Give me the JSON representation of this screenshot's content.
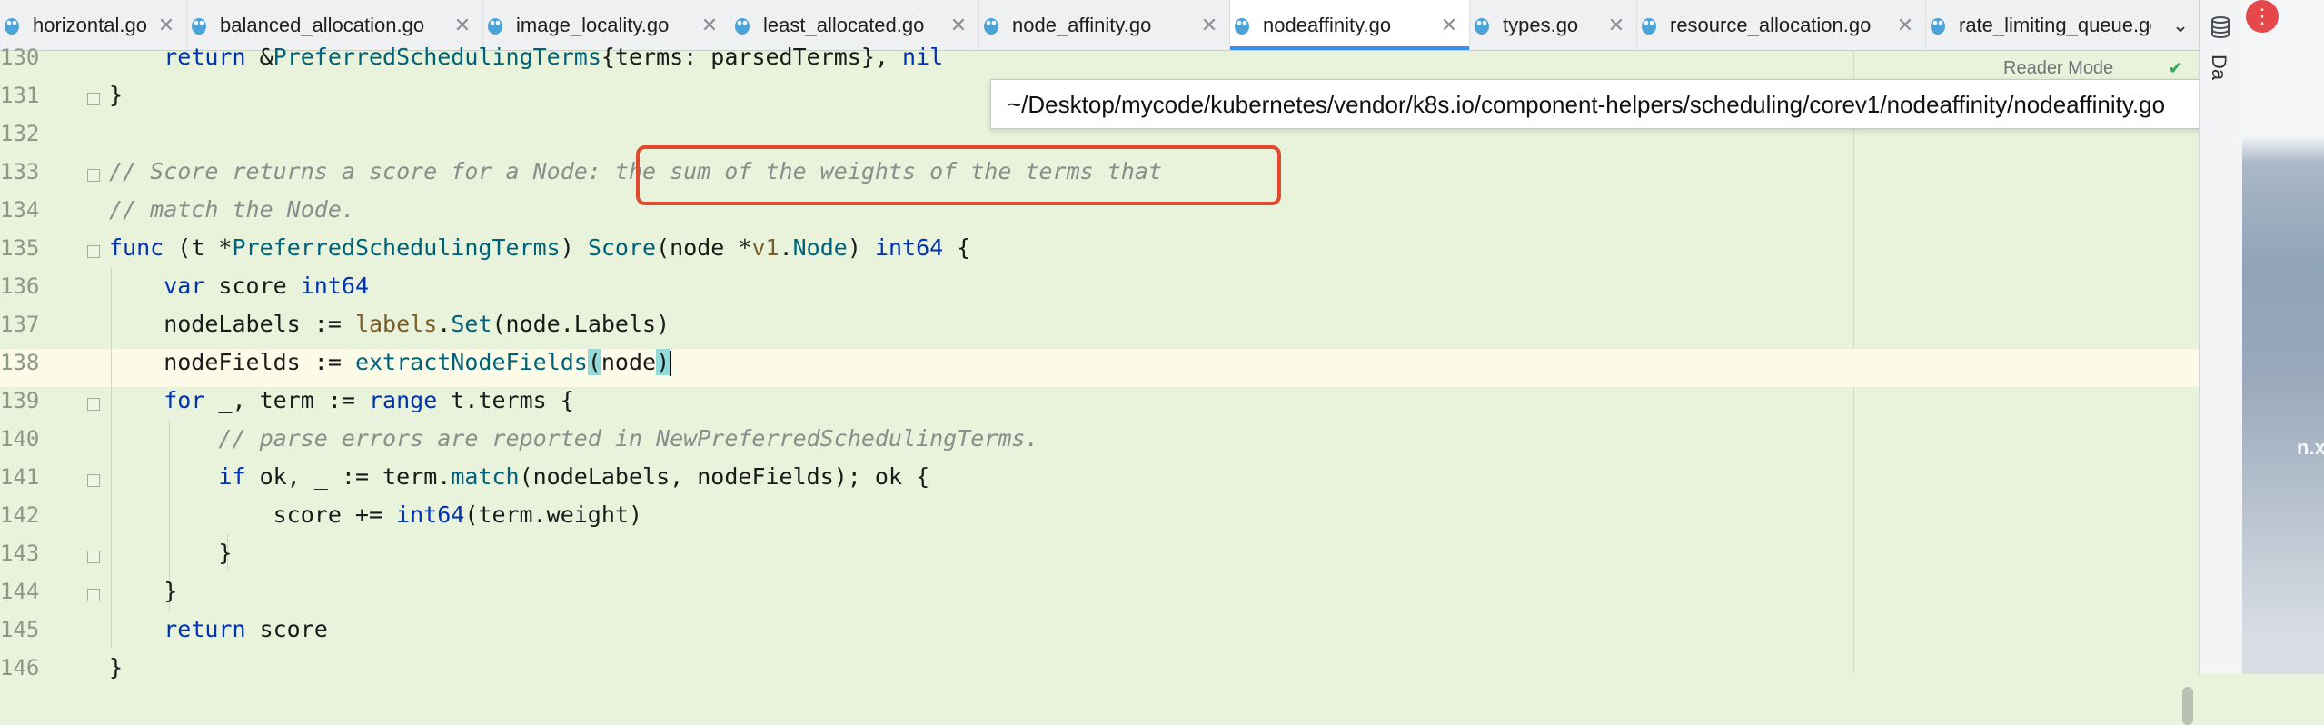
{
  "tabs": [
    {
      "label": "horizontal.go",
      "active": false
    },
    {
      "label": "balanced_allocation.go",
      "active": false
    },
    {
      "label": "image_locality.go",
      "active": false
    },
    {
      "label": "least_allocated.go",
      "active": false
    },
    {
      "label": "node_affinity.go",
      "active": false
    },
    {
      "label": "nodeaffinity.go",
      "active": true
    },
    {
      "label": "types.go",
      "active": false
    },
    {
      "label": "resource_allocation.go",
      "active": false
    },
    {
      "label": "rate_limiting_queue.go",
      "active": false
    }
  ],
  "tab_close_glyph": "✕",
  "tab_more_glyph": "⌄",
  "file_path": "~/Desktop/mycode/kubernetes/vendor/k8s.io/component-helpers/scheduling/corev1/nodeaffinity/nodeaffinity.go",
  "reader_mode_label": "Reader Mode",
  "right_panel_label": "Da",
  "desktop_peek_text": "n.x",
  "line_numbers": [
    "130",
    "131",
    "132",
    "133",
    "134",
    "135",
    "136",
    "137",
    "138",
    "139",
    "140",
    "141",
    "142",
    "143",
    "144",
    "145",
    "146"
  ],
  "current_line": "138",
  "colors": {
    "editor_bg": "#e9f2da",
    "keyword": "#0033b3",
    "function": "#00627a",
    "comment": "#8c8c8c",
    "highlight_box": "#e24a2f",
    "active_tab_indicator": "#3d8ee6"
  }
}
